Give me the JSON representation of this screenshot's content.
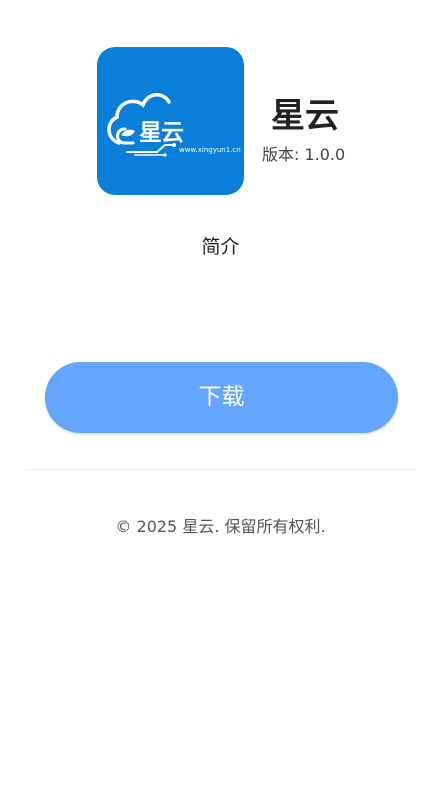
{
  "app": {
    "name": "星云",
    "version_text": "版本: 1.0.0",
    "icon": {
      "name": "xingyun-app-icon",
      "brand_text": "星云",
      "url_text": "www.xingyun1.cn",
      "background_color": "#0a7fda"
    }
  },
  "intro": {
    "label": "简介"
  },
  "actions": {
    "download_label": "下载",
    "download_color": "#64a5fd"
  },
  "footer": {
    "copyright": "© 2025 星云. 保留所有权利."
  }
}
